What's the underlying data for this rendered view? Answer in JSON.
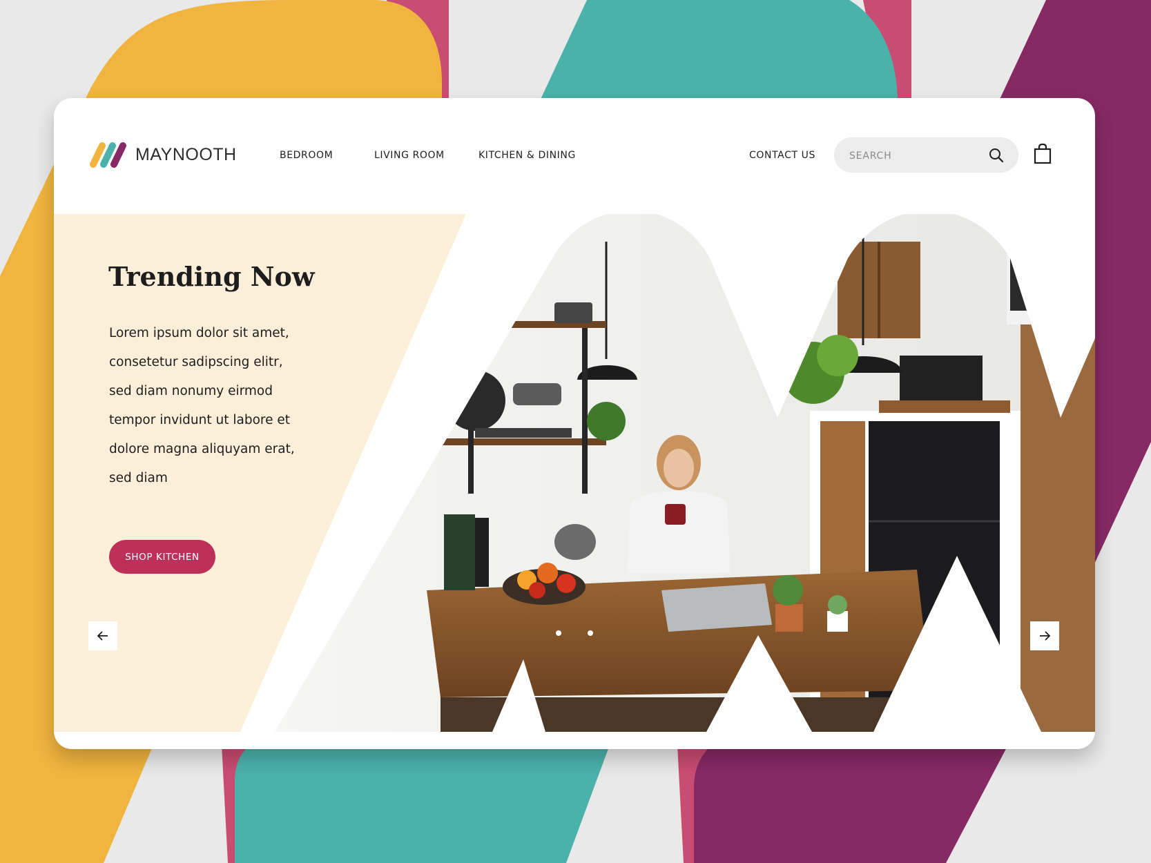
{
  "brand": {
    "name": "MAYNOOTH"
  },
  "nav": {
    "items": [
      {
        "label": "BEDROOM"
      },
      {
        "label": "LIVING ROOM"
      },
      {
        "label": "KITCHEN & DINING"
      }
    ],
    "contact_label": "CONTACT US"
  },
  "search": {
    "placeholder": "SEARCH"
  },
  "hero": {
    "title": "Trending Now",
    "body": "Lorem ipsum dolor sit amet, consetetur sadipscing elitr, sed diam nonumy eirmod tempor invidunt ut labore et dolore magna aliquyam erat, sed diam",
    "cta_label": "SHOP KITCHEN"
  },
  "carousel": {
    "slide_count": 2,
    "active_index": 0
  },
  "icons": {
    "logo": "maynooth-logo-mark",
    "search": "search-icon",
    "cart": "shopping-bag-icon",
    "prev": "arrow-left-icon",
    "next": "arrow-right-icon"
  },
  "colors": {
    "yellow": "#f0b43f",
    "teal": "#4bb2ab",
    "plum": "#862964",
    "pink": "#c94d72",
    "cta": "#bd3059",
    "hero_panel": "#fcefd9",
    "background": "#e9e9e9"
  }
}
